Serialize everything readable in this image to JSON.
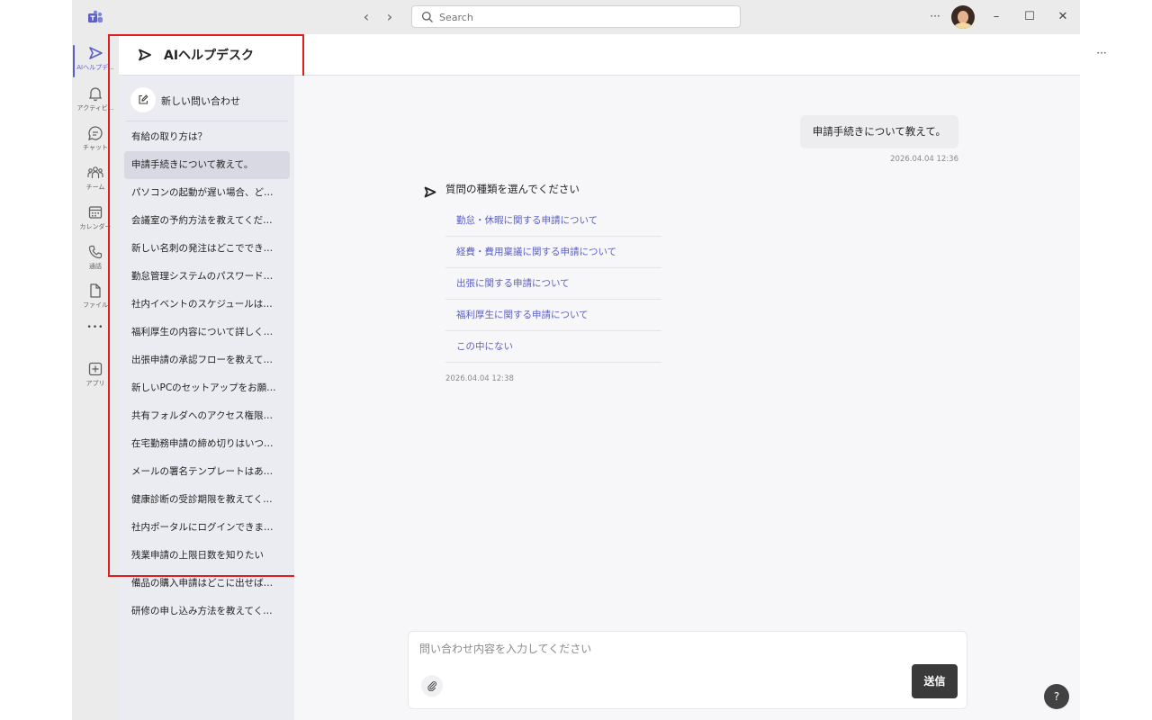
{
  "titlebar": {
    "search_placeholder": "Search",
    "more": "···",
    "minimize": "–",
    "maximize": "☐",
    "close": "✕",
    "back": "‹",
    "forward": "›"
  },
  "rail": {
    "items": [
      {
        "label": "AIヘルプデ...",
        "icon": "send-icon",
        "active": true
      },
      {
        "label": "アクティビ...",
        "icon": "bell-icon"
      },
      {
        "label": "チャット",
        "icon": "chat-icon"
      },
      {
        "label": "チーム",
        "icon": "teams-icon"
      },
      {
        "label": "カレンダー",
        "icon": "calendar-icon"
      },
      {
        "label": "通話",
        "icon": "phone-icon"
      },
      {
        "label": "ファイル",
        "icon": "file-icon"
      },
      {
        "label": "",
        "icon": "more-icon"
      },
      {
        "label": "アプリ",
        "icon": "apps-add-icon"
      }
    ],
    "more_glyph": "•••"
  },
  "header": {
    "title": "AIヘルプデスク",
    "more": "···"
  },
  "sidebar": {
    "new_inquiry": "新しい問い合わせ",
    "conversations": [
      "有給の取り方は？",
      "申請手続きについて教えて。",
      "パソコンの起動が遅い場合、ど…",
      "会議室の予約方法を教えてくだ…",
      "新しい名刺の発注はどこででき…",
      "勤怠管理システムのパスワード…",
      "社内イベントのスケジュールは…",
      "福利厚生の内容について詳しく…",
      "出張申請の承認フローを教えて…",
      "新しいPCのセットアップをお願…",
      "共有フォルダへのアクセス権限…",
      "在宅勤務申請の締め切りはいつ…",
      "メールの署名テンプレートはあ…",
      "健康診断の受診期限を教えてく…",
      "社内ポータルにログインできま…",
      "残業申請の上限日数を知りたい",
      "備品の購入申請はどこに出せば…",
      "研修の申し込み方法を教えてく…"
    ],
    "selected_index": 1
  },
  "chat": {
    "user_message": "申請手続きについて教えて。",
    "user_time": "2026.04.04 12:36",
    "bot_heading": "質問の種類を選んでください",
    "bot_options": [
      "勤怠・休暇に関する申請について",
      "経費・費用稟議に関する申請について",
      "出張に関する申請について",
      "福利厚生に関する申請について",
      "この中にない"
    ],
    "bot_time": "2026.04.04 12:38"
  },
  "composer": {
    "placeholder": "問い合わせ内容を入力してください",
    "send_label": "送信"
  },
  "help": "?",
  "colors": {
    "accent": "#5b5fc7",
    "highlight_border": "#e01e1e",
    "send_button": "#3a3a3a"
  }
}
